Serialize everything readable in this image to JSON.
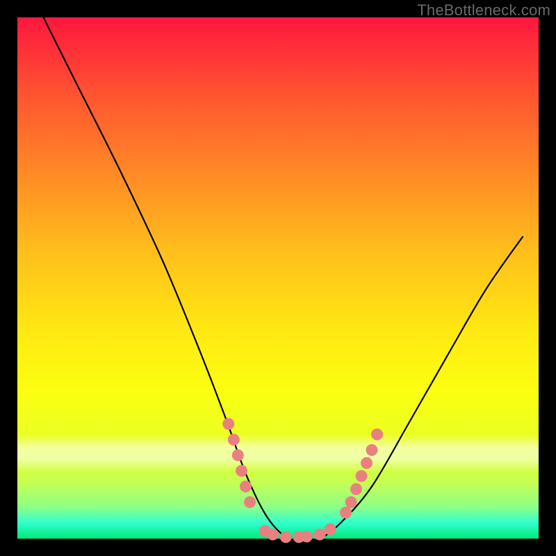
{
  "watermark": "TheBottleneck.com",
  "chart_data": {
    "type": "line",
    "title": "",
    "xlabel": "",
    "ylabel": "",
    "xlim": [
      0,
      100
    ],
    "ylim": [
      0,
      100
    ],
    "grid": false,
    "legend": false,
    "series": [
      {
        "name": "bottleneck-curve",
        "x": [
          5,
          12,
          20,
          28,
          35,
          40,
          44,
          48,
          52,
          55,
          58,
          62,
          68,
          75,
          83,
          90,
          97
        ],
        "y": [
          100,
          86,
          70,
          53,
          36,
          23,
          12,
          4,
          0,
          0,
          0,
          3,
          10,
          22,
          36,
          48,
          58
        ]
      }
    ],
    "markers": {
      "name": "highlight-dots",
      "color": "#e98080",
      "points": [
        {
          "x": 40.5,
          "y": 22
        },
        {
          "x": 41.5,
          "y": 19
        },
        {
          "x": 42.3,
          "y": 16
        },
        {
          "x": 43.0,
          "y": 13
        },
        {
          "x": 43.8,
          "y": 10
        },
        {
          "x": 44.6,
          "y": 7
        },
        {
          "x": 47.5,
          "y": 1.5
        },
        {
          "x": 49.0,
          "y": 0.8
        },
        {
          "x": 51.5,
          "y": 0.3
        },
        {
          "x": 54.0,
          "y": 0.3
        },
        {
          "x": 55.5,
          "y": 0.4
        },
        {
          "x": 58.0,
          "y": 0.8
        },
        {
          "x": 60.0,
          "y": 1.8
        },
        {
          "x": 63.0,
          "y": 5
        },
        {
          "x": 64.0,
          "y": 7
        },
        {
          "x": 65.0,
          "y": 9.5
        },
        {
          "x": 66.0,
          "y": 12
        },
        {
          "x": 67.0,
          "y": 14.5
        },
        {
          "x": 68.0,
          "y": 17
        },
        {
          "x": 69.0,
          "y": 20
        }
      ]
    },
    "background_gradient": {
      "top": "#ff163e",
      "mid": "#ffe812",
      "bottom": "#00e878"
    }
  }
}
